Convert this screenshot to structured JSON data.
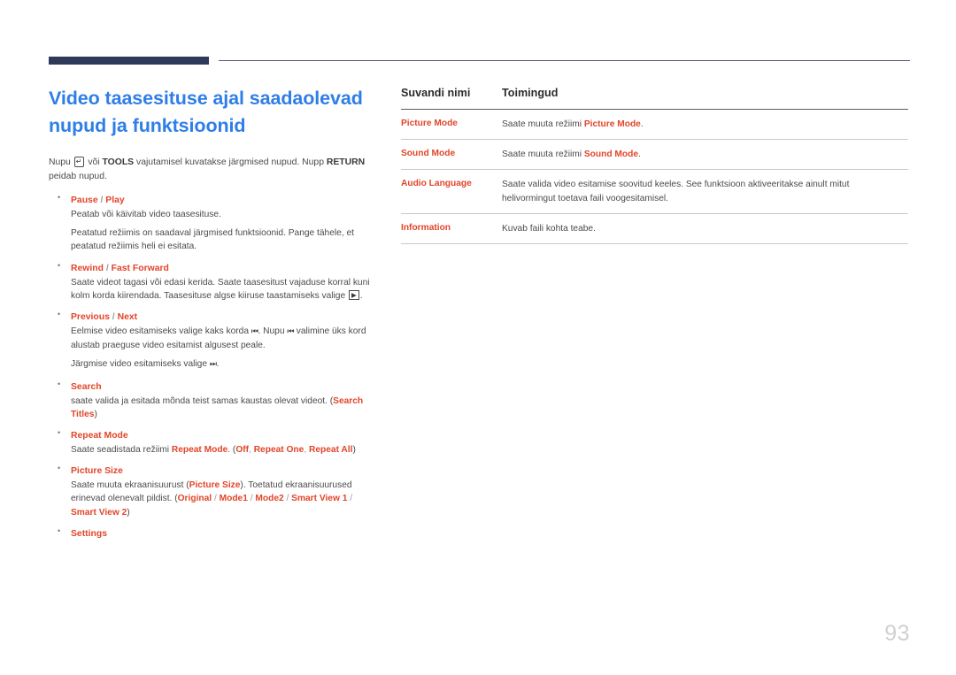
{
  "page": {
    "number": "93",
    "title_lines": [
      "Video taasesituse ajal saadaolevad",
      "nupud ja funktsioonid"
    ],
    "title_color": "#2f7ee8",
    "accent_color": "#e2452a",
    "rule_color": "#2e3a58"
  },
  "intro": {
    "part1": "Nupu",
    "keycap_icon": "enter-key-icon",
    "keycap_glyph": "↵",
    "part2": "või",
    "bold1": "TOOLS",
    "part3": "vajutamisel kuvatakse järgmised nupud. Nupp",
    "bold2": "RETURN",
    "part4": "peidab nupud."
  },
  "bullets": [
    {
      "term": "Pause / Play",
      "term_a": "Pause",
      "term_b": "Play",
      "paragraphs": [
        "Peatab või käivitab video taasesituse.",
        "Peatatud režiimis on saadaval järgmised funktsioonid. Pange tähele, et peatatud režiimis heli ei esitata."
      ]
    },
    {
      "term": "Rewind / Fast Forward",
      "term_a": "Rewind",
      "term_b": "Fast Forward",
      "body_a": "Saate videot tagasi või edasi kerida. Saate taasesitust vajaduse korral kuni kolm korda kiirendada. Taasesituse algse kiiruse taastamiseks valige",
      "glyph": "▶",
      "body_b": "."
    },
    {
      "term": "Previous / Next",
      "term_a": "Previous",
      "term_b": "Next",
      "line1_a": "Eelmise video esitamiseks valige kaks korda",
      "glyph_prev": "⏮",
      "line1_b": ". Nupu",
      "line1_c": "valimine üks kord alustab praeguse video esitamist algusest peale.",
      "line2_a": "Järgmise video esitamiseks valige",
      "glyph_next": "⏭",
      "line2_b": "."
    },
    {
      "term": "Search",
      "body_a": "saate valida ja esitada mõnda teist samas kaustas olevat videot. (",
      "kw": "Search Titles",
      "body_b": ")"
    },
    {
      "term": "Repeat Mode",
      "body_a": "Saate seadistada režiimi",
      "kw1": "Repeat Mode",
      "body_b": ". (",
      "opt1": "Off",
      "opt2": "Repeat One",
      "opt3": "Repeat All",
      "body_c": ")"
    },
    {
      "term": "Picture Size",
      "body_a": "Saate muuta ekraanisuurust (",
      "kw1": "Picture Size",
      "body_b": "). Toetatud ekraanisuurused erinevad olenevalt pildist. (",
      "opt1": "Original",
      "opt2": "Mode1",
      "opt3": "Mode2",
      "opt4": "Smart View 1",
      "opt5": "Smart View 2",
      "body_c": ")"
    },
    {
      "term": "Settings"
    }
  ],
  "table": {
    "headers": [
      "Suvandi nimi",
      "Toimingud"
    ],
    "rows": [
      {
        "name": "Picture Mode",
        "desc_a": "Saate muuta režiimi",
        "kw": "Picture Mode",
        "desc_b": "."
      },
      {
        "name": "Sound Mode",
        "desc_a": "Saate muuta režiimi",
        "kw": "Sound Mode",
        "desc_b": "."
      },
      {
        "name": "Audio Language",
        "desc_a": "Saate valida video esitamise soovitud keeles. See funktsioon aktiveeritakse ainult mitut helivormingut toetava faili voogesitamisel.",
        "kw": "",
        "desc_b": ""
      },
      {
        "name": "Information",
        "desc_a": "Kuvab faili kohta teabe.",
        "kw": "",
        "desc_b": ""
      }
    ]
  }
}
